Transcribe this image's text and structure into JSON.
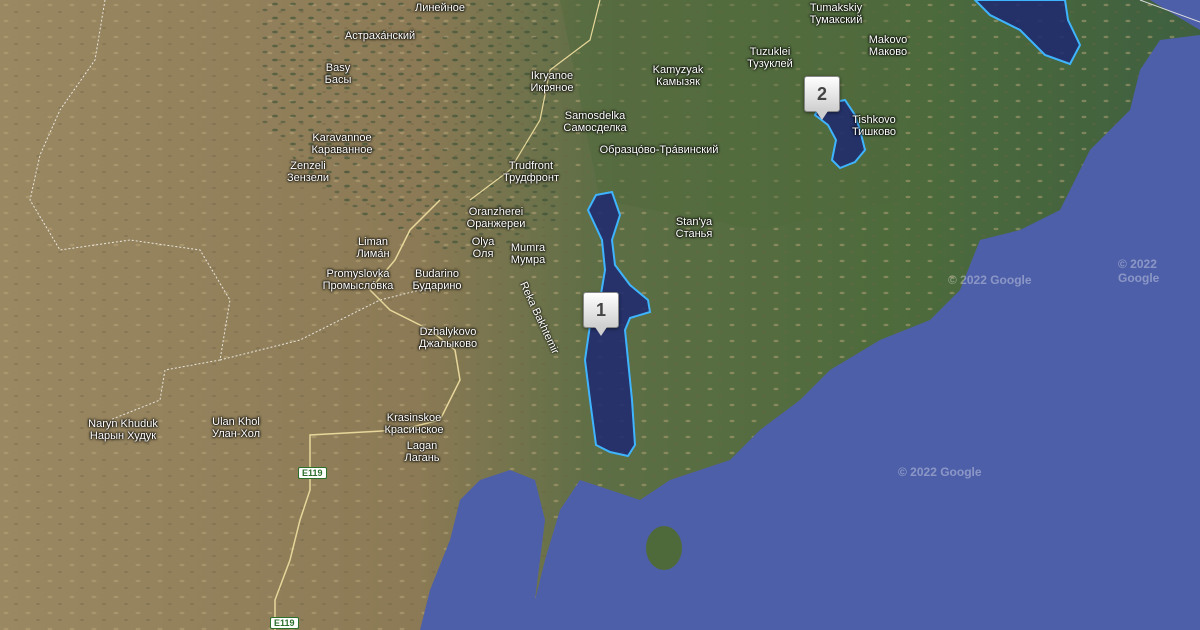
{
  "places": [
    {
      "id": "lineynoe",
      "lines": [
        "Линейное"
      ]
    },
    {
      "id": "astrakhansky",
      "lines": [
        "Астраха́нский"
      ]
    },
    {
      "id": "basy",
      "lines": [
        "Basy",
        "Басы"
      ]
    },
    {
      "id": "ikryanoe",
      "lines": [
        "Ikryanoe",
        "Икряное"
      ]
    },
    {
      "id": "kamyzyak",
      "lines": [
        "Kamyzyak",
        "Камызяк"
      ]
    },
    {
      "id": "tuzuklei",
      "lines": [
        "Tuzuklei",
        "Тузуклей"
      ]
    },
    {
      "id": "tumaksky",
      "lines": [
        "Tumakskiy",
        "Тумакский"
      ]
    },
    {
      "id": "makovo",
      "lines": [
        "Makovo",
        "Маково"
      ]
    },
    {
      "id": "samosdelka",
      "lines": [
        "Samosdelka",
        "Самосделка"
      ]
    },
    {
      "id": "tishkovo",
      "lines": [
        "Tishkovo",
        "Тишково"
      ]
    },
    {
      "id": "karavannoe",
      "lines": [
        "Karavannoe",
        "Караванное"
      ]
    },
    {
      "id": "obraztsovo",
      "lines": [
        "Образцо́во-Тра́винский"
      ]
    },
    {
      "id": "zenzeli",
      "lines": [
        "Zenzeli",
        "Зензели"
      ]
    },
    {
      "id": "trudfront",
      "lines": [
        "Trudfront",
        "Трудфронт"
      ]
    },
    {
      "id": "oranzherei",
      "lines": [
        "Oranzherei",
        "Оранжереи"
      ]
    },
    {
      "id": "stanya",
      "lines": [
        "Stan'ya",
        "Станья"
      ]
    },
    {
      "id": "liman",
      "lines": [
        "Liman",
        "Лима́н"
      ]
    },
    {
      "id": "olya",
      "lines": [
        "Olya",
        "Оля"
      ]
    },
    {
      "id": "mumra",
      "lines": [
        "Mumra",
        "Мумра"
      ]
    },
    {
      "id": "promyslovka",
      "lines": [
        "Promyslovka",
        "Промысло́вка"
      ]
    },
    {
      "id": "budarino",
      "lines": [
        "Budarino",
        "Бударино"
      ]
    },
    {
      "id": "dzhalykovo",
      "lines": [
        "Dzhalykovo",
        "Джалыково"
      ]
    },
    {
      "id": "krasinskoe",
      "lines": [
        "Krasinskoe",
        "Красинское"
      ]
    },
    {
      "id": "naryn",
      "lines": [
        "Naryn Khuduk",
        "Нарын Худук"
      ]
    },
    {
      "id": "ulankhol",
      "lines": [
        "Ulan Khol",
        "Улан-Хол"
      ]
    },
    {
      "id": "lagan",
      "lines": [
        "Lagan",
        "Лагань"
      ]
    }
  ],
  "river_label": "Reka Bakhtemir",
  "markers": [
    {
      "id": "1",
      "label": "1"
    },
    {
      "id": "2",
      "label": "2"
    }
  ],
  "routes": [
    "E119",
    "E119"
  ],
  "watermarks": [
    "© 2022 Google",
    "© 2022 Google",
    "© 2022 Google"
  ],
  "colors": {
    "sea": "#4d5fa8",
    "land": "#8a7a55",
    "delta": "#4e6a3a",
    "polygon_fill": "#1f2a6e",
    "polygon_stroke": "#3fb4ff"
  }
}
